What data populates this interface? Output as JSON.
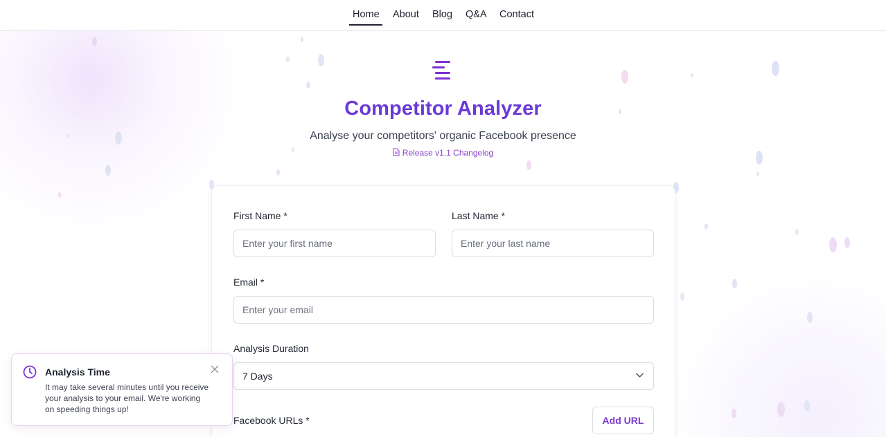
{
  "nav": {
    "items": [
      {
        "label": "Home",
        "active": true
      },
      {
        "label": "About",
        "active": false
      },
      {
        "label": "Blog",
        "active": false
      },
      {
        "label": "Q&A",
        "active": false
      },
      {
        "label": "Contact",
        "active": false
      }
    ]
  },
  "hero": {
    "icon": "menu-lines-icon",
    "title": "Competitor Analyzer",
    "subtitle": "Analyse your competitors' organic Facebook presence",
    "changelog_icon": "document-icon",
    "changelog_label": "Release v1.1 Changelog"
  },
  "form": {
    "first_name": {
      "label": "First Name *",
      "placeholder": "Enter your first name",
      "value": ""
    },
    "last_name": {
      "label": "Last Name *",
      "placeholder": "Enter your last name",
      "value": ""
    },
    "email": {
      "label": "Email *",
      "placeholder": "Enter your email",
      "value": ""
    },
    "duration": {
      "label": "Analysis Duration",
      "selected": "7 Days",
      "icon": "chevron-down-icon"
    },
    "facebook_urls": {
      "label": "Facebook URLs *",
      "add_label": "Add URL"
    }
  },
  "toast": {
    "icon": "clock-icon",
    "title": "Analysis Time",
    "body": "It may take several minutes until you receive your analysis to your email. We're working on speeding things up!",
    "close_icon": "close-icon"
  },
  "colors": {
    "accent": "#6a39d8",
    "accent_purple": "#8a3fc7",
    "text": "#1f2330",
    "border": "#d9dce3"
  }
}
